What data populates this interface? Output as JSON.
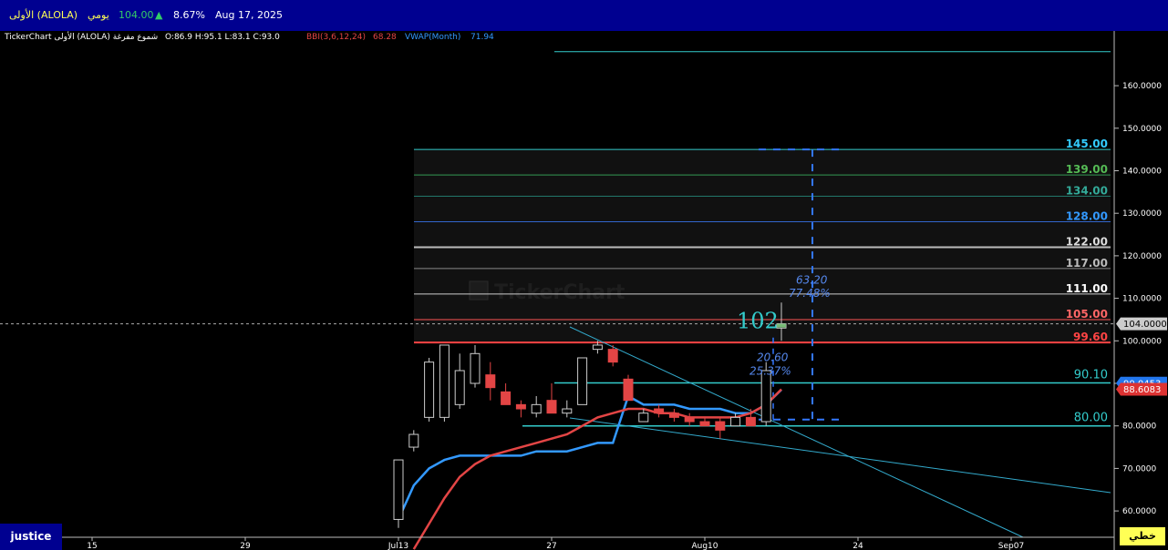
{
  "header": {
    "symbol": "الأولى (ALOLA)",
    "period": "يومي",
    "price": "104.00",
    "change_pct": "8.67%",
    "date": "Aug 17, 2025",
    "up_arrow": "▲"
  },
  "info": {
    "title": "TickerChart الأولى (ALOLA) شموع مفرغة",
    "ohlc": "O:86.9  H:95.1  L:83.1  C:93.0",
    "bbi_label": "BBI(3,6,12,24)",
    "bbi_value": "68.28",
    "vwap_label": "VWAP(Month)",
    "vwap_value": "71.94"
  },
  "footer": {
    "user": "justice",
    "mode": "خطي"
  },
  "watermark": "TickerChart",
  "chart_data": {
    "type": "candlestick",
    "ylim": [
      56,
      170
    ],
    "y_ticks": [
      "60.0000",
      "70.0000",
      "80.0000",
      "90.0000",
      "100.0000",
      "110.0000",
      "120.0000",
      "130.0000",
      "140.0000",
      "150.0000",
      "160.0000"
    ],
    "y_tick_values": [
      60,
      70,
      80,
      90,
      100,
      110,
      120,
      130,
      140,
      150,
      160
    ],
    "x_ticks": [
      "15",
      "29",
      "Jul13",
      "27",
      "Aug10",
      "24",
      "Sep07"
    ],
    "x_tick_slots": [
      -20,
      -10,
      0,
      10,
      20,
      30,
      40
    ],
    "current_price_badge": "104.0000",
    "current_price": 104,
    "vwap_badge": "90.0453",
    "vwap_badge_value": 90.05,
    "bbi_badge": "88.6083",
    "bbi_badge_value": 88.61,
    "candles": [
      {
        "o": 58,
        "h": 72,
        "l": 56,
        "c": 72
      },
      {
        "o": 75,
        "h": 79,
        "l": 74,
        "c": 78
      },
      {
        "o": 82,
        "h": 96,
        "l": 81,
        "c": 95
      },
      {
        "o": 82,
        "h": 99,
        "l": 81,
        "c": 99
      },
      {
        "o": 85,
        "h": 97,
        "l": 84,
        "c": 93
      },
      {
        "o": 90,
        "h": 99,
        "l": 89,
        "c": 97
      },
      {
        "o": 92,
        "h": 95,
        "l": 86,
        "c": 89
      },
      {
        "o": 88,
        "h": 90,
        "l": 85,
        "c": 85
      },
      {
        "o": 85,
        "h": 86,
        "l": 82,
        "c": 84
      },
      {
        "o": 83,
        "h": 87,
        "l": 82,
        "c": 85
      },
      {
        "o": 86,
        "h": 90,
        "l": 83,
        "c": 83
      },
      {
        "o": 83,
        "h": 86,
        "l": 82,
        "c": 84
      },
      {
        "o": 85,
        "h": 96,
        "l": 85,
        "c": 96
      },
      {
        "o": 98,
        "h": 100,
        "l": 97,
        "c": 99
      },
      {
        "o": 98,
        "h": 99,
        "l": 94,
        "c": 95
      },
      {
        "o": 91,
        "h": 92,
        "l": 86,
        "c": 86
      },
      {
        "o": 81,
        "h": 84,
        "l": 81,
        "c": 83
      },
      {
        "o": 84,
        "h": 85,
        "l": 82,
        "c": 83
      },
      {
        "o": 83,
        "h": 84,
        "l": 81,
        "c": 82
      },
      {
        "o": 82,
        "h": 83,
        "l": 80,
        "c": 81
      },
      {
        "o": 81,
        "h": 82,
        "l": 80,
        "c": 80
      },
      {
        "o": 81,
        "h": 82,
        "l": 77,
        "c": 79
      },
      {
        "o": 80,
        "h": 83,
        "l": 80,
        "c": 82
      },
      {
        "o": 82,
        "h": 84,
        "l": 81,
        "c": 80
      },
      {
        "o": 81,
        "h": 95,
        "l": 80,
        "c": 93
      },
      {
        "o": 103,
        "h": 109,
        "l": 100,
        "c": 104
      }
    ],
    "series": [
      {
        "name": "VWAP(Month)",
        "color": "#3399ff",
        "points": [
          [
            0,
            58
          ],
          [
            1,
            66
          ],
          [
            2,
            70
          ],
          [
            3,
            72
          ],
          [
            4,
            73
          ],
          [
            5,
            73
          ],
          [
            6,
            73
          ],
          [
            7,
            73
          ],
          [
            8,
            73
          ],
          [
            9,
            74
          ],
          [
            10,
            74
          ],
          [
            11,
            74
          ],
          [
            12,
            75
          ],
          [
            13,
            76
          ],
          [
            14,
            76
          ],
          [
            15,
            87
          ],
          [
            16,
            85
          ],
          [
            17,
            85
          ],
          [
            18,
            85
          ],
          [
            19,
            84
          ],
          [
            20,
            84
          ],
          [
            21,
            84
          ],
          [
            22,
            83
          ],
          [
            23,
            83
          ],
          [
            24,
            85
          ],
          [
            25,
            88.5
          ]
        ]
      },
      {
        "name": "BBI(3,6,12,24)",
        "color": "#e34545",
        "points": [
          [
            1,
            51
          ],
          [
            2,
            57
          ],
          [
            3,
            63
          ],
          [
            4,
            68
          ],
          [
            5,
            71
          ],
          [
            6,
            73
          ],
          [
            7,
            74
          ],
          [
            8,
            75
          ],
          [
            9,
            76
          ],
          [
            10,
            77
          ],
          [
            11,
            78
          ],
          [
            12,
            80
          ],
          [
            13,
            82
          ],
          [
            14,
            83
          ],
          [
            15,
            84
          ],
          [
            16,
            84
          ],
          [
            17,
            83
          ],
          [
            18,
            83
          ],
          [
            19,
            82
          ],
          [
            20,
            82
          ],
          [
            21,
            82
          ],
          [
            22,
            82
          ],
          [
            23,
            83
          ],
          [
            24,
            85
          ],
          [
            25,
            88.6
          ]
        ]
      }
    ],
    "levels": [
      {
        "value": 145,
        "label": "145.00",
        "color": "#33cccc",
        "label_color": "#33ccff"
      },
      {
        "value": 139,
        "label": "139.00",
        "color": "#339955",
        "label_color": "#55bb55"
      },
      {
        "value": 134,
        "label": "134.00",
        "color": "#22776a",
        "label_color": "#33aa99"
      },
      {
        "value": 128,
        "label": "128.00",
        "color": "#3366cc",
        "label_color": "#3399ff"
      },
      {
        "value": 122,
        "label": "122.00",
        "color": "#bbbbbb",
        "label_color": "#dddddd"
      },
      {
        "value": 117,
        "label": "117.00",
        "color": "#888888",
        "label_color": "#bbbbbb"
      },
      {
        "value": 111,
        "label": "111.00",
        "color": "#cccccc",
        "label_color": "#ffffff"
      },
      {
        "value": 105,
        "label": "105.00",
        "color": "#ff5555",
        "label_color": "#ff6666"
      },
      {
        "value": 99.6,
        "label": "99.60",
        "color": "#ff4444",
        "label_color": "#ff4444"
      }
    ],
    "support_lines": [
      {
        "value": 90.1,
        "label": "90.10"
      },
      {
        "value": 80,
        "label": "80.00"
      }
    ],
    "top_line_value": 168,
    "annotations": {
      "big_number": "102",
      "measure_top_1": "63.20",
      "measure_top_2": "77.48%",
      "measure_mid_1": "20.60",
      "measure_mid_2": "25.37%"
    }
  }
}
